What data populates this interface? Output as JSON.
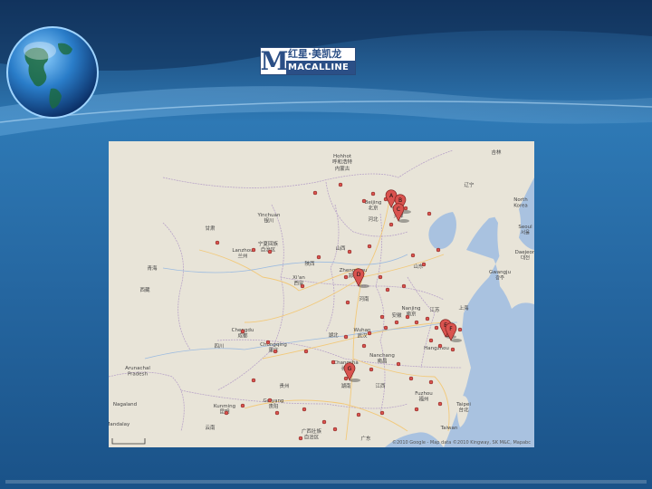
{
  "logo": {
    "chinese": "红星·美凯龙",
    "mark": "M",
    "english": "MACALLINE"
  },
  "map": {
    "attribution": "©2010 Google - Map data ©2010 Kingway, SK M&C, Mapabc",
    "labels": [
      {
        "id": "huhhot",
        "text": "Hohhot\n呼和浩特"
      },
      {
        "id": "neimenggu",
        "text": "内蒙古"
      },
      {
        "id": "jilin",
        "text": "吉林"
      },
      {
        "id": "liaoning",
        "text": "辽宁"
      },
      {
        "id": "beijing",
        "text": "Beijing\n北京"
      },
      {
        "id": "tianjin",
        "text": "天津"
      },
      {
        "id": "hebei",
        "text": "河北"
      },
      {
        "id": "north-korea",
        "text": "North\nKorea"
      },
      {
        "id": "seoul",
        "text": "Seoul\n서울"
      },
      {
        "id": "daejeon",
        "text": "Daejeon\n대전"
      },
      {
        "id": "gwangju",
        "text": "Gwangju\n광주"
      },
      {
        "id": "yinchuan",
        "text": "Yinchuan\n银川"
      },
      {
        "id": "gansu",
        "text": "甘肃"
      },
      {
        "id": "ningxia",
        "text": "宁夏回族\n自治区"
      },
      {
        "id": "qinghai",
        "text": "青海"
      },
      {
        "id": "lanzhou",
        "text": "Lanzhou\n兰州"
      },
      {
        "id": "shanxi",
        "text": "山西"
      },
      {
        "id": "shandong",
        "text": "山东"
      },
      {
        "id": "zhengzhou",
        "text": "Zhengzhou\n郑州"
      },
      {
        "id": "shaanxi",
        "text": "陕西"
      },
      {
        "id": "xian",
        "text": "Xi'an\n西安"
      },
      {
        "id": "henan",
        "text": "河南"
      },
      {
        "id": "nanjing",
        "text": "Nanjing\n南京"
      },
      {
        "id": "anhui",
        "text": "安徽"
      },
      {
        "id": "shanghai",
        "text": "上海"
      },
      {
        "id": "jiangsu",
        "text": "江苏"
      },
      {
        "id": "chengdu",
        "text": "Chengdu\n成都"
      },
      {
        "id": "sichuan",
        "text": "四川"
      },
      {
        "id": "chongqing",
        "text": "Chongqing\n重庆"
      },
      {
        "id": "wuhan",
        "text": "Wuhan\n武汉"
      },
      {
        "id": "hubei",
        "text": "湖北"
      },
      {
        "id": "hangzhou",
        "text": "Hangzhou"
      },
      {
        "id": "nanchang",
        "text": "Nanchang\n南昌"
      },
      {
        "id": "changsha",
        "text": "Changsha\n长沙"
      },
      {
        "id": "hunan",
        "text": "湖南"
      },
      {
        "id": "jiangxi",
        "text": "江西"
      },
      {
        "id": "fuzhou",
        "text": "Fuzhou\n福州"
      },
      {
        "id": "guizhou",
        "text": "贵州"
      },
      {
        "id": "guiyang",
        "text": "Guiyang\n贵阳"
      },
      {
        "id": "arunachal",
        "text": "Arunachal\nPradesh"
      },
      {
        "id": "nagaland",
        "text": "Nagaland"
      },
      {
        "id": "kunming",
        "text": "Kunming\n昆明"
      },
      {
        "id": "yunnan",
        "text": "云南"
      },
      {
        "id": "guangxi",
        "text": "广西壮族\n自治区"
      },
      {
        "id": "guangdong",
        "text": "广东"
      },
      {
        "id": "taipei",
        "text": "Taipei\n台北"
      },
      {
        "id": "taiwan",
        "text": "Taiwan"
      },
      {
        "id": "mandalay",
        "text": "Mandalay"
      },
      {
        "id": "xizang",
        "text": "西藏"
      }
    ],
    "pins": [
      "A",
      "B",
      "C",
      "D",
      "E",
      "F",
      "G"
    ]
  },
  "colors": {
    "background": "#1f5f96",
    "land": "#e8e4d8",
    "sea": "#a9c2e0",
    "marker": "#d9534f",
    "border": "#b9a4c8"
  }
}
